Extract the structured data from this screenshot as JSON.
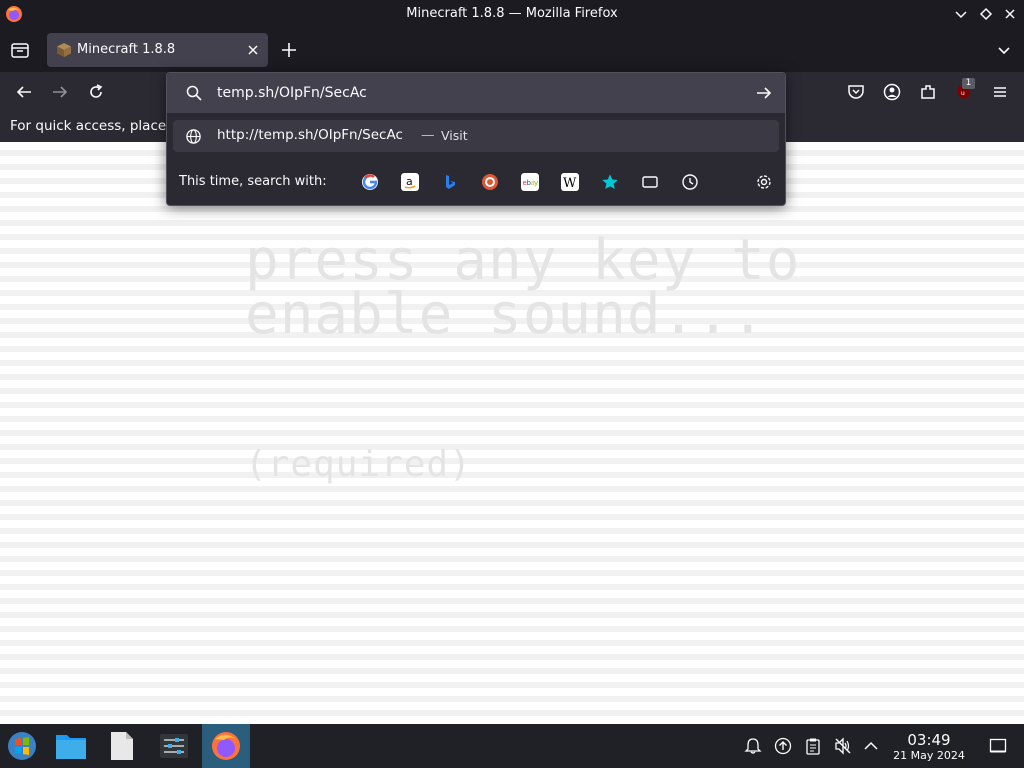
{
  "window": {
    "title": "Minecraft 1.8.8 — Mozilla Firefox"
  },
  "tab": {
    "label": "Minecraft 1.8.8"
  },
  "bookmarks": {
    "hint": "For quick access, place"
  },
  "urlbar": {
    "value": "temp.sh/OIpFn/SecAc",
    "result_url": "http://temp.sh/OIpFn/SecAc",
    "result_sep": "—",
    "result_action": "Visit",
    "search_with_label": "This time, search with:",
    "engines": [
      "google",
      "amazon",
      "bing",
      "duckduckgo",
      "ebay",
      "wikipedia",
      "bookmarks",
      "tabs",
      "history"
    ]
  },
  "ublock_badge": "1",
  "page": {
    "line1": "press any key to",
    "line2": "enable sound...",
    "line3": "(required)"
  },
  "taskbar": {
    "time": "03:49",
    "date": "21 May 2024"
  },
  "colors": {
    "toolbar": "#2b2a33",
    "titlebar": "#1c1b22",
    "taskbar": "#202126",
    "accent": "#3daee9"
  }
}
